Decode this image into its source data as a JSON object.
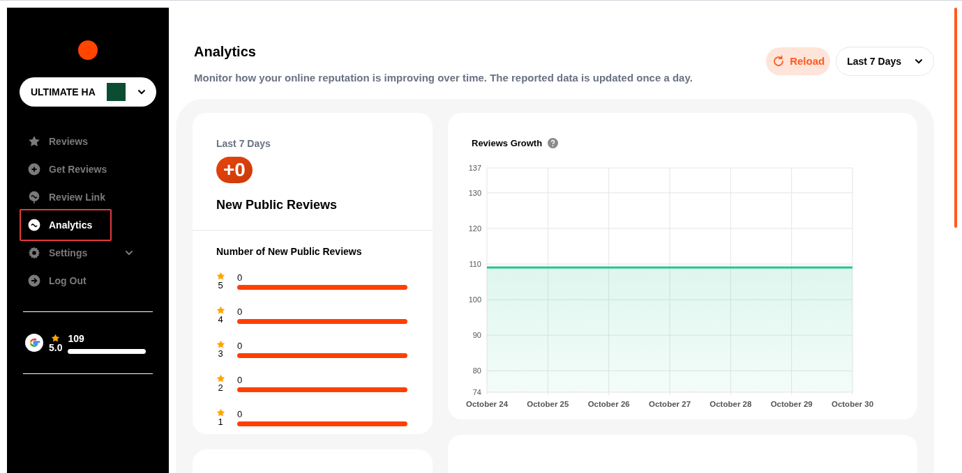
{
  "sidebar": {
    "business": {
      "name": "ULTIMATE HA"
    },
    "nav": [
      {
        "label": "Reviews",
        "selected": false,
        "expandable": false
      },
      {
        "label": "Get Reviews",
        "selected": false,
        "expandable": false
      },
      {
        "label": "Review Link",
        "selected": false,
        "expandable": false
      },
      {
        "label": "Analytics",
        "selected": true,
        "expandable": false
      },
      {
        "label": "Settings",
        "selected": false,
        "expandable": true
      },
      {
        "label": "Log Out",
        "selected": false,
        "expandable": false
      }
    ],
    "rating": {
      "score": "5.0",
      "count": "109"
    }
  },
  "header": {
    "title": "Analytics",
    "subtitle": "Monitor how your online reputation is improving over time. The reported data is updated once a day.",
    "reload": "Reload",
    "period": "Last 7 Days"
  },
  "summary": {
    "period": "Last 7 Days",
    "delta": "+0",
    "label": "New Public Reviews",
    "breakdown_title": "Number of New Public Reviews",
    "rows": [
      {
        "stars": "5",
        "count": "0"
      },
      {
        "stars": "4",
        "count": "0"
      },
      {
        "stars": "3",
        "count": "0"
      },
      {
        "stars": "2",
        "count": "0"
      },
      {
        "stars": "1",
        "count": "0"
      }
    ]
  },
  "growth": {
    "title": "Reviews Growth",
    "chart_data": {
      "type": "area",
      "categories": [
        "October 24",
        "October 25",
        "October 26",
        "October 27",
        "October 28",
        "October 29",
        "October 30"
      ],
      "grid": true,
      "series": [
        {
          "color": "#22c58b",
          "values": [
            109,
            109,
            109,
            109,
            109,
            109,
            109
          ]
        }
      ],
      "ylim": [
        74,
        137
      ],
      "yticks": [
        74,
        80,
        90,
        100,
        110,
        120,
        130,
        137
      ]
    }
  }
}
